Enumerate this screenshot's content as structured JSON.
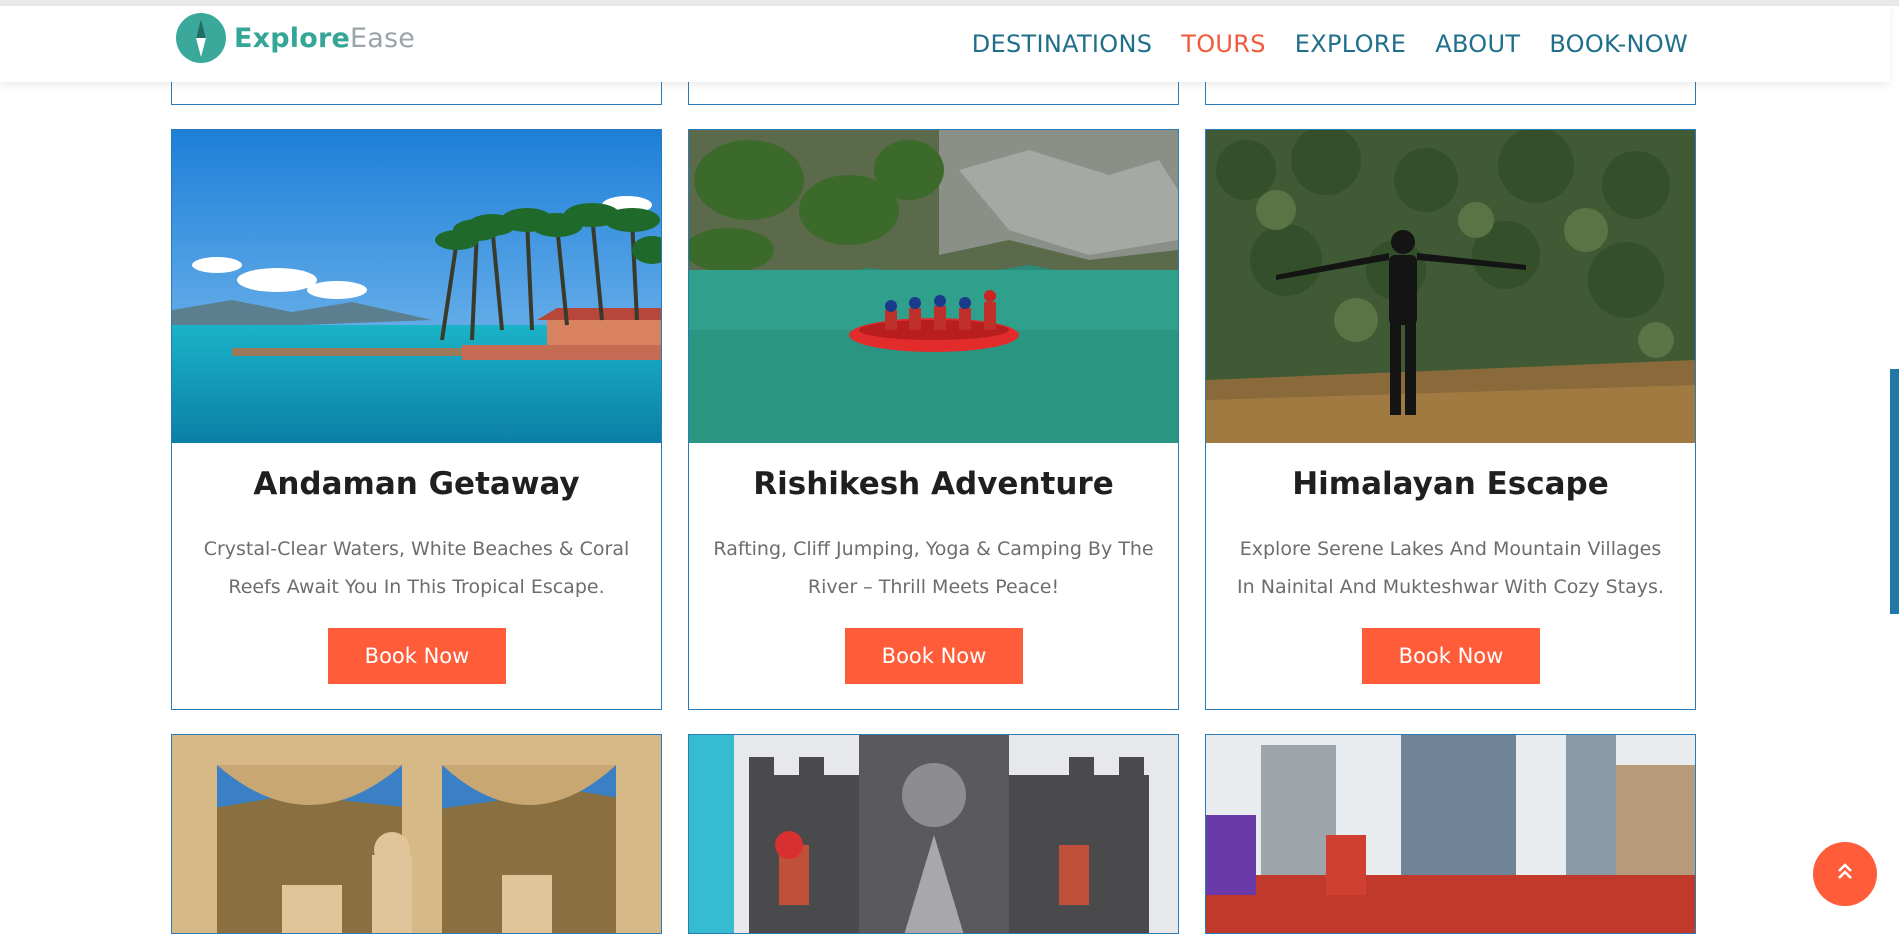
{
  "brand": {
    "name_part1": "Explore",
    "name_part2": "Ease",
    "logo_icon": "compass-icon"
  },
  "nav": {
    "items": [
      {
        "label": "DESTINATIONS",
        "active": false
      },
      {
        "label": "TOURS",
        "active": true
      },
      {
        "label": "EXPLORE",
        "active": false
      },
      {
        "label": "ABOUT",
        "active": false
      },
      {
        "label": "BOOK-NOW",
        "active": false
      }
    ]
  },
  "tours": [
    {
      "title": "Andaman Getaway",
      "description": "Crystal-Clear Waters, White Beaches & Coral Reefs Await You In This Tropical Escape.",
      "button_label": "Book Now",
      "image": "tropical-beach-palm-trees"
    },
    {
      "title": "Rishikesh Adventure",
      "description": "Rafting, Cliff Jumping, Yoga & Camping By The River – Thrill Meets Peace!",
      "button_label": "Book Now",
      "image": "river-rafting"
    },
    {
      "title": "Himalayan Escape",
      "description": "Explore Serene Lakes And Mountain Villages In Nainital And Mukteshwar With Cozy Stays.",
      "button_label": "Book Now",
      "image": "person-forest-hills"
    }
  ],
  "next_row_images": [
    "palace-arches",
    "castle-theme-park",
    "city-skyscrapers"
  ],
  "scroll_top": {
    "icon": "double-chevron-up-icon"
  },
  "colors": {
    "accent": "#ff5c3a",
    "nav_link": "#1f6f8b",
    "nav_active": "#f05a3c",
    "card_border": "#2a7bb8",
    "brand_teal": "#35a597"
  }
}
